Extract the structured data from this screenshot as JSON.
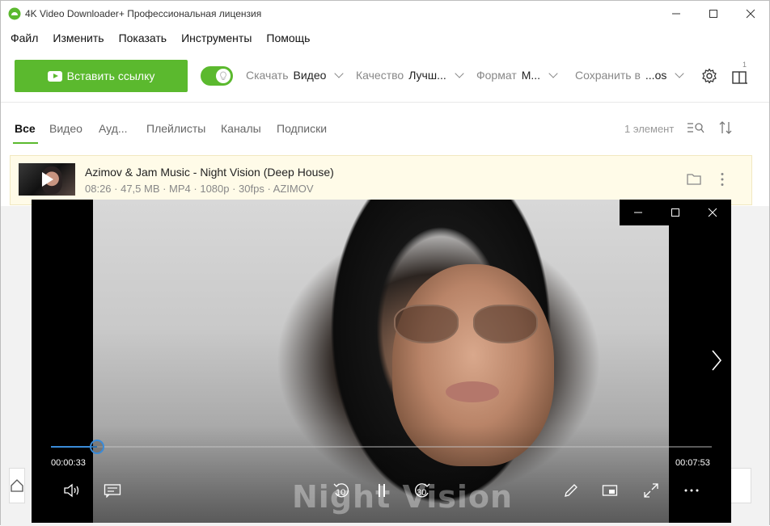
{
  "window": {
    "title": "4K Video Downloader+ Профессиональная лицензия",
    "controls": [
      "minimize",
      "maximize",
      "close"
    ]
  },
  "menu": [
    "Файл",
    "Изменить",
    "Показать",
    "Инструменты",
    "Помощь"
  ],
  "toolbar": {
    "paste_label": "Вставить ссылку",
    "smart_mode_enabled": true,
    "download_label": "Скачать",
    "download_value": "Видео",
    "quality_label": "Качество",
    "quality_value": "Лучш...",
    "format_label": "Формат",
    "format_value": "M...",
    "save_label": "Сохранить в",
    "save_value": "...os",
    "notifications_count": "1"
  },
  "tabs": [
    "Все",
    "Видео",
    "Ауд...",
    "Плейлисты",
    "Каналы",
    "Подписки"
  ],
  "active_tab": "Все",
  "items_count": "1 элемент",
  "list": [
    {
      "title": "Azimov & Jam Music - Night Vision (Deep House)",
      "meta": "08:26 · 47,5 MB · MP4 · 1080p · 30fps · AZIMOV"
    }
  ],
  "player": {
    "current_time": "00:00:33",
    "total_time": "00:07:53",
    "progress": 0.07,
    "skip_back": "10",
    "skip_forward": "30",
    "caption": "Night Vision"
  },
  "colors": {
    "accent": "#5bb92e",
    "progress": "#3a8bd8"
  }
}
